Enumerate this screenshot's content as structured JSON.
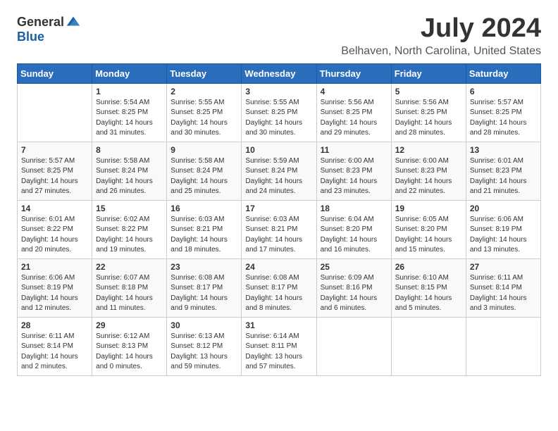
{
  "header": {
    "logo_general": "General",
    "logo_blue": "Blue",
    "title": "July 2024",
    "subtitle": "Belhaven, North Carolina, United States"
  },
  "weekdays": [
    "Sunday",
    "Monday",
    "Tuesday",
    "Wednesday",
    "Thursday",
    "Friday",
    "Saturday"
  ],
  "weeks": [
    [
      {
        "day": "",
        "sunrise": "",
        "sunset": "",
        "daylight": ""
      },
      {
        "day": "1",
        "sunrise": "Sunrise: 5:54 AM",
        "sunset": "Sunset: 8:25 PM",
        "daylight": "Daylight: 14 hours and 31 minutes."
      },
      {
        "day": "2",
        "sunrise": "Sunrise: 5:55 AM",
        "sunset": "Sunset: 8:25 PM",
        "daylight": "Daylight: 14 hours and 30 minutes."
      },
      {
        "day": "3",
        "sunrise": "Sunrise: 5:55 AM",
        "sunset": "Sunset: 8:25 PM",
        "daylight": "Daylight: 14 hours and 30 minutes."
      },
      {
        "day": "4",
        "sunrise": "Sunrise: 5:56 AM",
        "sunset": "Sunset: 8:25 PM",
        "daylight": "Daylight: 14 hours and 29 minutes."
      },
      {
        "day": "5",
        "sunrise": "Sunrise: 5:56 AM",
        "sunset": "Sunset: 8:25 PM",
        "daylight": "Daylight: 14 hours and 28 minutes."
      },
      {
        "day": "6",
        "sunrise": "Sunrise: 5:57 AM",
        "sunset": "Sunset: 8:25 PM",
        "daylight": "Daylight: 14 hours and 28 minutes."
      }
    ],
    [
      {
        "day": "7",
        "sunrise": "Sunrise: 5:57 AM",
        "sunset": "Sunset: 8:25 PM",
        "daylight": "Daylight: 14 hours and 27 minutes."
      },
      {
        "day": "8",
        "sunrise": "Sunrise: 5:58 AM",
        "sunset": "Sunset: 8:24 PM",
        "daylight": "Daylight: 14 hours and 26 minutes."
      },
      {
        "day": "9",
        "sunrise": "Sunrise: 5:58 AM",
        "sunset": "Sunset: 8:24 PM",
        "daylight": "Daylight: 14 hours and 25 minutes."
      },
      {
        "day": "10",
        "sunrise": "Sunrise: 5:59 AM",
        "sunset": "Sunset: 8:24 PM",
        "daylight": "Daylight: 14 hours and 24 minutes."
      },
      {
        "day": "11",
        "sunrise": "Sunrise: 6:00 AM",
        "sunset": "Sunset: 8:23 PM",
        "daylight": "Daylight: 14 hours and 23 minutes."
      },
      {
        "day": "12",
        "sunrise": "Sunrise: 6:00 AM",
        "sunset": "Sunset: 8:23 PM",
        "daylight": "Daylight: 14 hours and 22 minutes."
      },
      {
        "day": "13",
        "sunrise": "Sunrise: 6:01 AM",
        "sunset": "Sunset: 8:23 PM",
        "daylight": "Daylight: 14 hours and 21 minutes."
      }
    ],
    [
      {
        "day": "14",
        "sunrise": "Sunrise: 6:01 AM",
        "sunset": "Sunset: 8:22 PM",
        "daylight": "Daylight: 14 hours and 20 minutes."
      },
      {
        "day": "15",
        "sunrise": "Sunrise: 6:02 AM",
        "sunset": "Sunset: 8:22 PM",
        "daylight": "Daylight: 14 hours and 19 minutes."
      },
      {
        "day": "16",
        "sunrise": "Sunrise: 6:03 AM",
        "sunset": "Sunset: 8:21 PM",
        "daylight": "Daylight: 14 hours and 18 minutes."
      },
      {
        "day": "17",
        "sunrise": "Sunrise: 6:03 AM",
        "sunset": "Sunset: 8:21 PM",
        "daylight": "Daylight: 14 hours and 17 minutes."
      },
      {
        "day": "18",
        "sunrise": "Sunrise: 6:04 AM",
        "sunset": "Sunset: 8:20 PM",
        "daylight": "Daylight: 14 hours and 16 minutes."
      },
      {
        "day": "19",
        "sunrise": "Sunrise: 6:05 AM",
        "sunset": "Sunset: 8:20 PM",
        "daylight": "Daylight: 14 hours and 15 minutes."
      },
      {
        "day": "20",
        "sunrise": "Sunrise: 6:06 AM",
        "sunset": "Sunset: 8:19 PM",
        "daylight": "Daylight: 14 hours and 13 minutes."
      }
    ],
    [
      {
        "day": "21",
        "sunrise": "Sunrise: 6:06 AM",
        "sunset": "Sunset: 8:19 PM",
        "daylight": "Daylight: 14 hours and 12 minutes."
      },
      {
        "day": "22",
        "sunrise": "Sunrise: 6:07 AM",
        "sunset": "Sunset: 8:18 PM",
        "daylight": "Daylight: 14 hours and 11 minutes."
      },
      {
        "day": "23",
        "sunrise": "Sunrise: 6:08 AM",
        "sunset": "Sunset: 8:17 PM",
        "daylight": "Daylight: 14 hours and 9 minutes."
      },
      {
        "day": "24",
        "sunrise": "Sunrise: 6:08 AM",
        "sunset": "Sunset: 8:17 PM",
        "daylight": "Daylight: 14 hours and 8 minutes."
      },
      {
        "day": "25",
        "sunrise": "Sunrise: 6:09 AM",
        "sunset": "Sunset: 8:16 PM",
        "daylight": "Daylight: 14 hours and 6 minutes."
      },
      {
        "day": "26",
        "sunrise": "Sunrise: 6:10 AM",
        "sunset": "Sunset: 8:15 PM",
        "daylight": "Daylight: 14 hours and 5 minutes."
      },
      {
        "day": "27",
        "sunrise": "Sunrise: 6:11 AM",
        "sunset": "Sunset: 8:14 PM",
        "daylight": "Daylight: 14 hours and 3 minutes."
      }
    ],
    [
      {
        "day": "28",
        "sunrise": "Sunrise: 6:11 AM",
        "sunset": "Sunset: 8:14 PM",
        "daylight": "Daylight: 14 hours and 2 minutes."
      },
      {
        "day": "29",
        "sunrise": "Sunrise: 6:12 AM",
        "sunset": "Sunset: 8:13 PM",
        "daylight": "Daylight: 14 hours and 0 minutes."
      },
      {
        "day": "30",
        "sunrise": "Sunrise: 6:13 AM",
        "sunset": "Sunset: 8:12 PM",
        "daylight": "Daylight: 13 hours and 59 minutes."
      },
      {
        "day": "31",
        "sunrise": "Sunrise: 6:14 AM",
        "sunset": "Sunset: 8:11 PM",
        "daylight": "Daylight: 13 hours and 57 minutes."
      },
      {
        "day": "",
        "sunrise": "",
        "sunset": "",
        "daylight": ""
      },
      {
        "day": "",
        "sunrise": "",
        "sunset": "",
        "daylight": ""
      },
      {
        "day": "",
        "sunrise": "",
        "sunset": "",
        "daylight": ""
      }
    ]
  ]
}
